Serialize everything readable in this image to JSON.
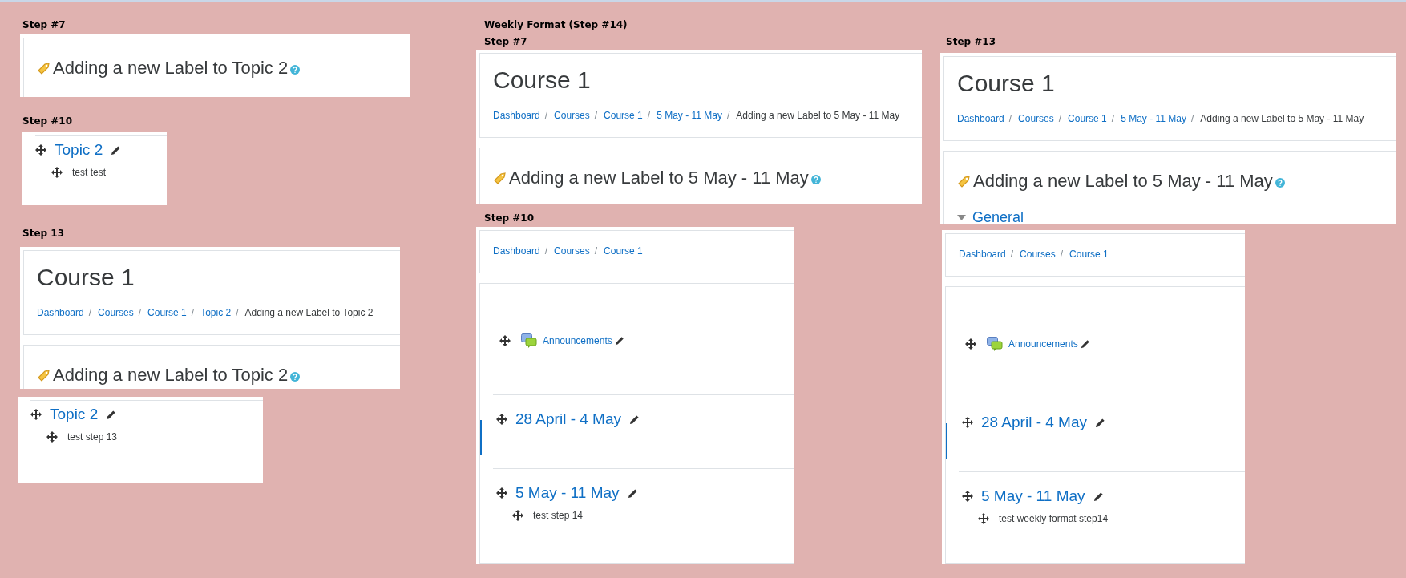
{
  "captions": [
    {
      "text": "Step #7"
    },
    {
      "text": "Step #10"
    },
    {
      "text": "Step 13"
    },
    {
      "text": "Weekly Format (Step #14)"
    },
    {
      "text": "Step #7"
    },
    {
      "text": "Step #10"
    },
    {
      "text": "Step #13"
    }
  ],
  "panels": [
    {
      "cards": [
        {
          "blocks": [
            {
              "kind": "label_heading",
              "text": "Adding a new Label to Topic 2"
            }
          ]
        }
      ]
    },
    {
      "cards": [
        {
          "blocks": [
            {
              "kind": "section",
              "title": "Topic 2",
              "items": [
                "test test"
              ]
            }
          ]
        }
      ]
    },
    {
      "cards": [
        {
          "blocks": [
            {
              "kind": "course_title",
              "text": "Course 1"
            },
            {
              "kind": "breadcrumb",
              "links": [
                {
                  "text": "Dashboard",
                  "sep": "/"
                },
                {
                  "text": "Courses",
                  "sep": "/"
                },
                {
                  "text": "Course 1",
                  "sep": "/"
                },
                {
                  "text": "Topic 2",
                  "sep": "/"
                }
              ],
              "current": "Adding a new Label to Topic 2"
            }
          ]
        },
        {
          "blocks": [
            {
              "kind": "label_heading",
              "text": "Adding a new Label to Topic 2"
            }
          ]
        }
      ]
    },
    {
      "cards": [
        {
          "blocks": [
            {
              "kind": "section",
              "title": "Topic 2",
              "items": [
                "test step 13"
              ]
            }
          ]
        }
      ]
    },
    {
      "cards": [
        {
          "blocks": [
            {
              "kind": "course_title",
              "text": "Course 1"
            },
            {
              "kind": "breadcrumb",
              "links": [
                {
                  "text": "Dashboard",
                  "sep": "/"
                },
                {
                  "text": "Courses",
                  "sep": "/"
                },
                {
                  "text": "Course 1",
                  "sep": "/"
                },
                {
                  "text": "5 May - 11 May",
                  "sep": "/"
                }
              ],
              "current": "Adding a new Label to 5 May - 11 May"
            }
          ]
        },
        {
          "blocks": [
            {
              "kind": "label_heading",
              "text": "Adding a new Label to 5 May - 11 May"
            }
          ]
        }
      ]
    },
    {
      "cards": [
        {
          "blocks": [
            {
              "kind": "breadcrumb",
              "links": [
                {
                  "text": "Dashboard",
                  "sep": "/"
                },
                {
                  "text": "Courses",
                  "sep": "/"
                },
                {
                  "text": "Course 1"
                }
              ]
            }
          ]
        },
        {
          "blocks": [
            {
              "kind": "activity",
              "name": "Announcements"
            },
            {
              "kind": "section",
              "title": "28 April - 4 May",
              "current": true
            },
            {
              "kind": "section",
              "title": "5 May - 11 May",
              "current": false,
              "items": [
                "test step 14"
              ]
            }
          ]
        }
      ]
    },
    {
      "cards": [
        {
          "blocks": [
            {
              "kind": "course_title",
              "text": "Course 1"
            },
            {
              "kind": "breadcrumb",
              "links": [
                {
                  "text": "Dashboard",
                  "sep": "/"
                },
                {
                  "text": "Courses",
                  "sep": "/"
                },
                {
                  "text": "Course 1",
                  "sep": "/"
                },
                {
                  "text": "5 May - 11 May",
                  "sep": "/"
                }
              ],
              "current": "Adding a new Label to 5 May - 11 May"
            }
          ]
        },
        {
          "blocks": [
            {
              "kind": "label_heading",
              "text": "Adding a new Label to 5 May - 11 May"
            },
            {
              "kind": "general",
              "text": "General"
            }
          ]
        }
      ]
    },
    {
      "cards": [
        {
          "blocks": [
            {
              "kind": "breadcrumb",
              "links": [
                {
                  "text": "Dashboard",
                  "sep": "/"
                },
                {
                  "text": "Courses",
                  "sep": "/"
                },
                {
                  "text": "Course 1"
                }
              ]
            }
          ]
        },
        {
          "blocks": [
            {
              "kind": "activity",
              "name": "Announcements"
            },
            {
              "kind": "section",
              "title": "28 April - 4 May",
              "current": true
            },
            {
              "kind": "section",
              "title": "5 May - 11 May",
              "current": false,
              "items": [
                "test weekly format step14"
              ]
            }
          ]
        }
      ]
    }
  ]
}
